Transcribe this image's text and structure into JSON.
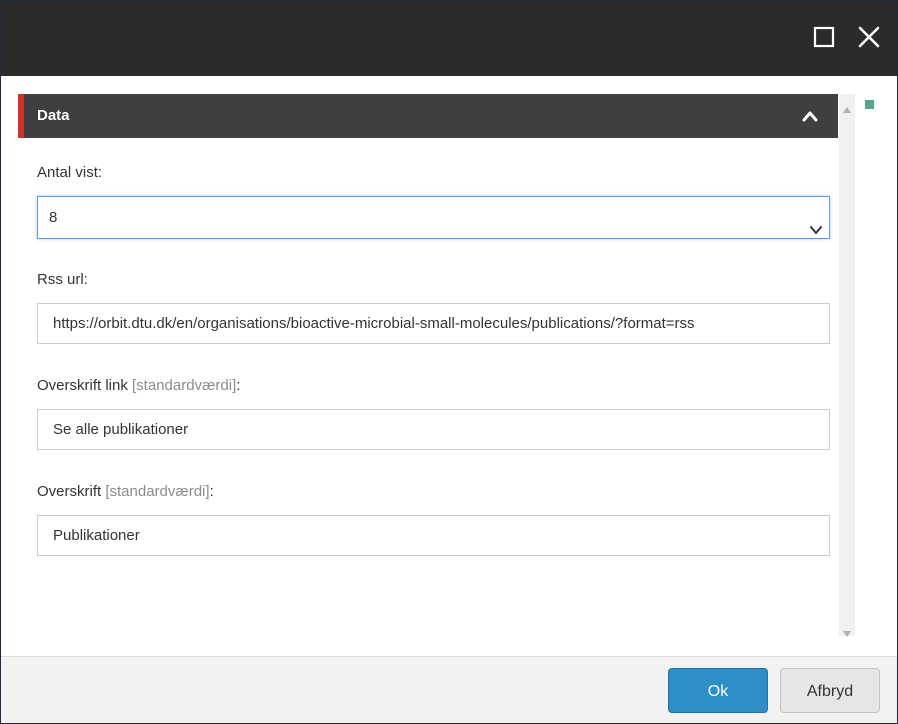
{
  "window": {
    "maximize_icon": "maximize-icon",
    "close_icon": "close-icon"
  },
  "section": {
    "title": "Data",
    "accent_color": "#d0312d",
    "collapse_icon": "chevron-up-icon"
  },
  "fields": {
    "antal_vist": {
      "label": "Antal vist:",
      "value": "8"
    },
    "rss_url": {
      "label": "Rss url:",
      "value": "https://orbit.dtu.dk/en/organisations/bioactive-microbial-small-molecules/publications/?format=rss"
    },
    "overskrift_link": {
      "label": "Overskrift link",
      "hint": "[standardværdi]",
      "suffix": ":",
      "value": "Se alle publikationer"
    },
    "overskrift": {
      "label": "Overskrift",
      "hint": "[standardværdi]",
      "suffix": ":",
      "value": "Publikationer"
    }
  },
  "footer": {
    "ok_label": "Ok",
    "cancel_label": "Afbryd",
    "ok_color": "#2d8fc6"
  }
}
